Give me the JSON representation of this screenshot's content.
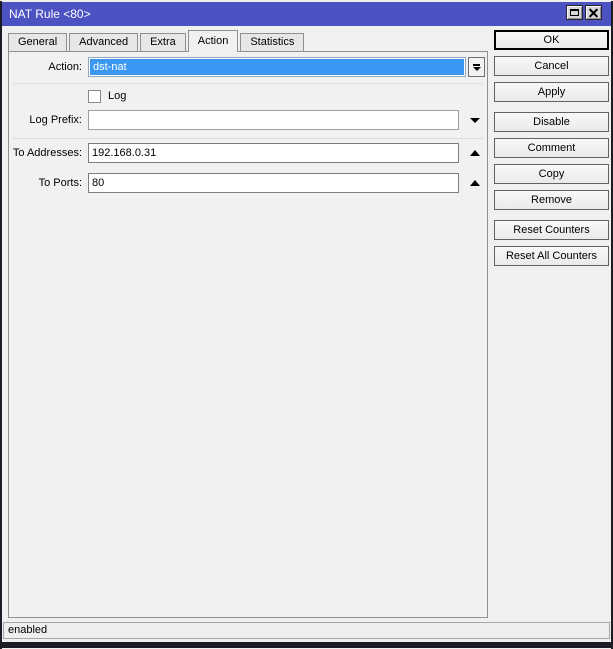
{
  "window": {
    "title": "NAT Rule <80>"
  },
  "titlebar_icons": {
    "maximize": "maximize-icon",
    "close": "close-icon"
  },
  "tabs": [
    {
      "label": "General",
      "active": false
    },
    {
      "label": "Advanced",
      "active": false
    },
    {
      "label": "Extra",
      "active": false
    },
    {
      "label": "Action",
      "active": true
    },
    {
      "label": "Statistics",
      "active": false
    }
  ],
  "form": {
    "action": {
      "label": "Action:",
      "value": "dst-nat"
    },
    "log": {
      "label": "Log",
      "checked": false
    },
    "log_prefix": {
      "label": "Log Prefix:",
      "value": ""
    },
    "to_addresses": {
      "label": "To Addresses:",
      "value": "192.168.0.31"
    },
    "to_ports": {
      "label": "To Ports:",
      "value": "80"
    }
  },
  "buttons": [
    {
      "label": "OK"
    },
    {
      "label": "Cancel"
    },
    {
      "label": "Apply"
    },
    {
      "label": "Disable"
    },
    {
      "label": "Comment"
    },
    {
      "label": "Copy"
    },
    {
      "label": "Remove"
    },
    {
      "label": "Reset Counters"
    },
    {
      "label": "Reset All Counters"
    }
  ],
  "status_bar": {
    "text": "enabled"
  },
  "colors": {
    "titlebar": "#4d52c2",
    "selection_blue": "#3a97f2",
    "dialog_bg": "#f0f0f0",
    "frame_dark": "#1c1c24"
  }
}
